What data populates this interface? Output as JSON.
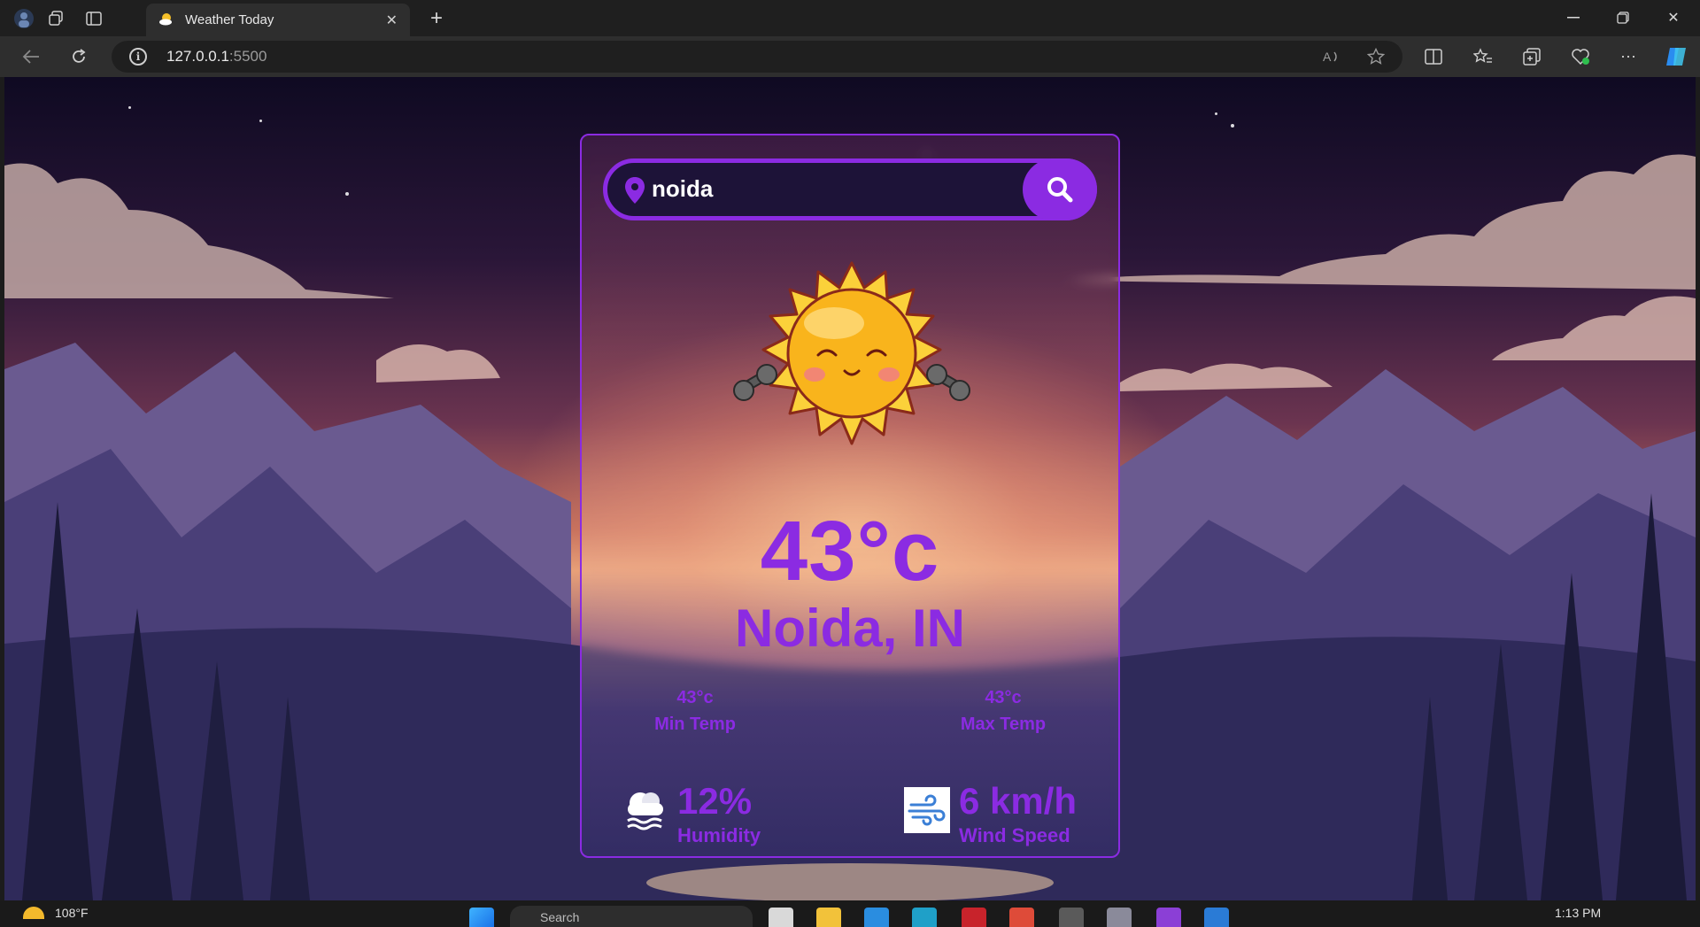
{
  "browser": {
    "tab_title": "Weather Today",
    "url_host": "127.0.0.1",
    "url_port": ":5500"
  },
  "weather": {
    "search_value": "noida",
    "temperature": "43°c",
    "location": "Noida, IN",
    "min_temp": {
      "value": "43°c",
      "label": "Min Temp"
    },
    "max_temp": {
      "value": "43°c",
      "label": "Max Temp"
    },
    "humidity": {
      "value": "12%",
      "label": "Humidity"
    },
    "wind": {
      "value": "6 km/h",
      "label": "Wind Speed"
    }
  },
  "colors": {
    "accent": "#8b2be2",
    "search_bg": "#1d1338"
  },
  "taskbar": {
    "weather_temp": "108°F",
    "search_placeholder": "Search",
    "time": "1:13 PM"
  }
}
